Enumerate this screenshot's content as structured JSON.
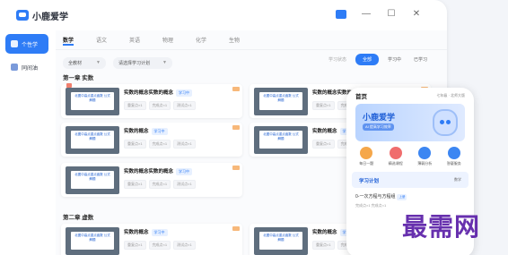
{
  "app": {
    "title": "小鹿爱学"
  },
  "sidebar": {
    "items": [
      {
        "label": "个性学"
      },
      {
        "label": "同间油"
      }
    ]
  },
  "tabs": [
    "数学",
    "语文",
    "英语",
    "物理",
    "化学",
    "生物"
  ],
  "filters": {
    "grade": "全教材",
    "plan": "请选择学习计划"
  },
  "status_tabs": [
    "学习状态",
    "全部",
    "学习中",
    "已学习"
  ],
  "chapters": [
    {
      "title": "第一章 实数"
    },
    {
      "title": "第二章 虚数"
    }
  ],
  "cards": [
    {
      "title": "实数的概念实数的概念",
      "tag": "学习中",
      "thumb": "北图中高点重点函数\n公式解题",
      "stats": [
        "重复点×1",
        "完成点×1",
        "测试点×1"
      ]
    },
    {
      "title": "实数的概念实数的概念",
      "tag": "学习中",
      "thumb": "北图中高点重点函数\n公式解题",
      "stats": [
        "重复点×1",
        "完成点×1",
        "测试点×1"
      ]
    },
    {
      "title": "实数的概念",
      "tag": "学习中",
      "thumb": "北图中高点重点函数\n公式解题",
      "stats": [
        "重复点×1",
        "完成点×1",
        "测试点×1"
      ]
    },
    {
      "title": "实数的概念",
      "tag": "学习中",
      "thumb": "北图中高点重点函数\n公式解题",
      "stats": [
        "重复点×1",
        "完成点×1",
        "测试点×1"
      ]
    },
    {
      "title": "实数的概念实数的概念",
      "tag": "学习中",
      "thumb": "北图中高点重点函数\n公式解题",
      "stats": [
        "重复点×1",
        "完成点×1",
        "测试点×1"
      ]
    },
    {
      "title": "实数的概念",
      "tag": "学习中",
      "thumb": "北图中高点重点函数\n公式解题",
      "stats": [
        "重复点×1",
        "完成点×1",
        "测试点×1"
      ]
    },
    {
      "title": "实数的概念",
      "tag": "学习中",
      "thumb": "北图中高点重点函数\n公式解题",
      "stats": [
        "重复点×1",
        "完成点×1",
        "测试点×1"
      ]
    }
  ],
  "phone": {
    "title": "首页",
    "meta": "七年级 · 北师大版",
    "banner_title": "小鹿爱学",
    "banner_sub": "AI 提高学习效率",
    "menu": [
      {
        "label": "每日一题",
        "color": "#f5a74a"
      },
      {
        "label": "精选课程",
        "color": "#f06d6d"
      },
      {
        "label": "薄弱分析",
        "color": "#3c86f2"
      },
      {
        "label": "答疑服务",
        "color": "#3c86f2"
      }
    ],
    "plan_title": "学习计划",
    "plan_sub": "数学",
    "course_title": "0-一次方程与方程组",
    "course_tag": "上册",
    "course_meta": "完成点×1  完成点×1"
  },
  "watermark": "最需网",
  "colors": {
    "accent": "#2e7cf6",
    "watermark": "#5b1fa8"
  }
}
